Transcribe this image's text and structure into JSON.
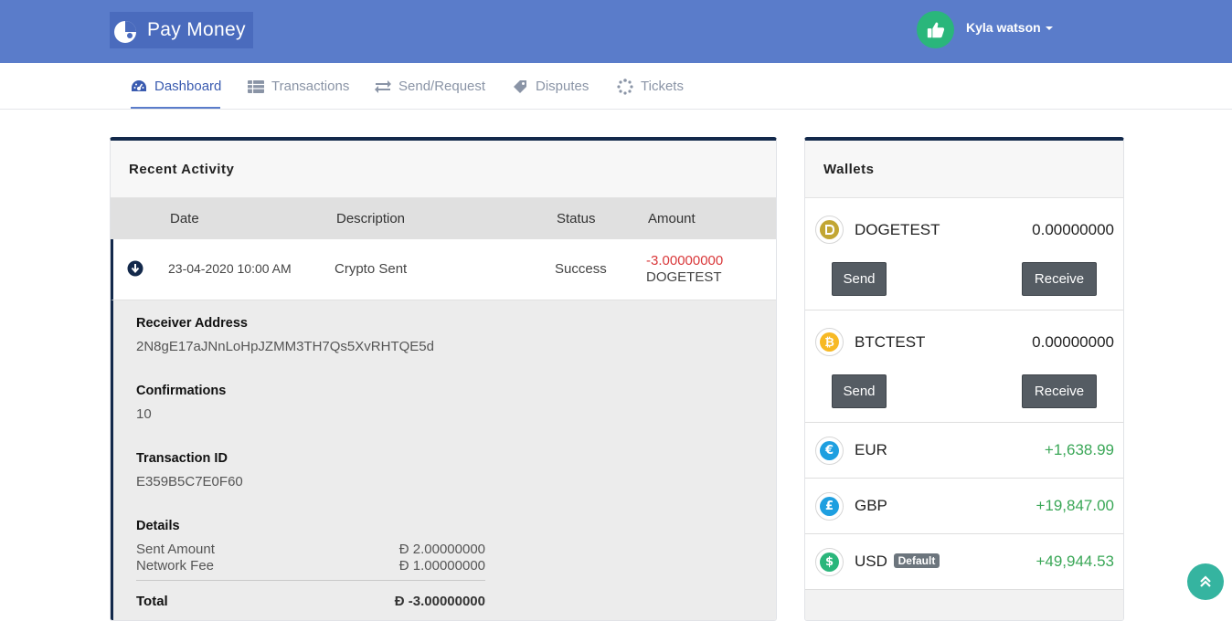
{
  "app": {
    "logo_text": "Pay Money"
  },
  "user": {
    "name": "Kyla watson"
  },
  "nav": {
    "items": [
      {
        "label": "Dashboard",
        "icon": "dashboard-icon",
        "active": true
      },
      {
        "label": "Transactions",
        "icon": "table-list-icon",
        "active": false
      },
      {
        "label": "Send/Request",
        "icon": "exchange-arrows-icon",
        "active": false
      },
      {
        "label": "Disputes",
        "icon": "ticket-tag-icon",
        "active": false
      },
      {
        "label": "Tickets",
        "icon": "spinner-icon",
        "active": false
      }
    ]
  },
  "activity": {
    "title": "Recent Activity",
    "columns": [
      "Date",
      "Description",
      "Status",
      "Amount"
    ],
    "row": {
      "date": "23-04-2020 10:00 AM",
      "description": "Crypto Sent",
      "status": "Success",
      "amount": "-3.00000000",
      "currency": "DOGETEST"
    },
    "details": {
      "receiver_label": "Receiver Address",
      "receiver_value": "2N8gE17aJNnLoHpJZMM3TH7Qs5XvRHTQE5d",
      "confirmations_label": "Confirmations",
      "confirmations_value": "10",
      "txid_label": "Transaction ID",
      "txid_value": "E359B5C7E0F60",
      "details_label": "Details",
      "sent_amount_label": "Sent Amount",
      "sent_amount_value": "Đ 2.00000000",
      "network_fee_label": "Network Fee",
      "network_fee_value": "Đ 1.00000000",
      "total_label": "Total",
      "total_value": "Đ -3.00000000"
    }
  },
  "wallets": {
    "title": "Wallets",
    "send_label": "Send",
    "receive_label": "Receive",
    "default_badge": "Default",
    "items": [
      {
        "name": "DOGETEST",
        "amount": "0.00000000",
        "icon": "dogecoin-icon"
      },
      {
        "name": "BTCTEST",
        "amount": "0.00000000",
        "icon": "bitcoin-icon"
      },
      {
        "name": "EUR",
        "amount": "+1,638.99",
        "icon": "euro-icon"
      },
      {
        "name": "GBP",
        "amount": "+19,847.00",
        "icon": "pound-icon"
      },
      {
        "name": "USD",
        "amount": "+49,944.53",
        "icon": "dollar-icon"
      }
    ]
  },
  "colors": {
    "topbar": "#5a7cca",
    "positive": "#3aa757",
    "negative": "#d9383a",
    "card_accent": "#13294b"
  }
}
